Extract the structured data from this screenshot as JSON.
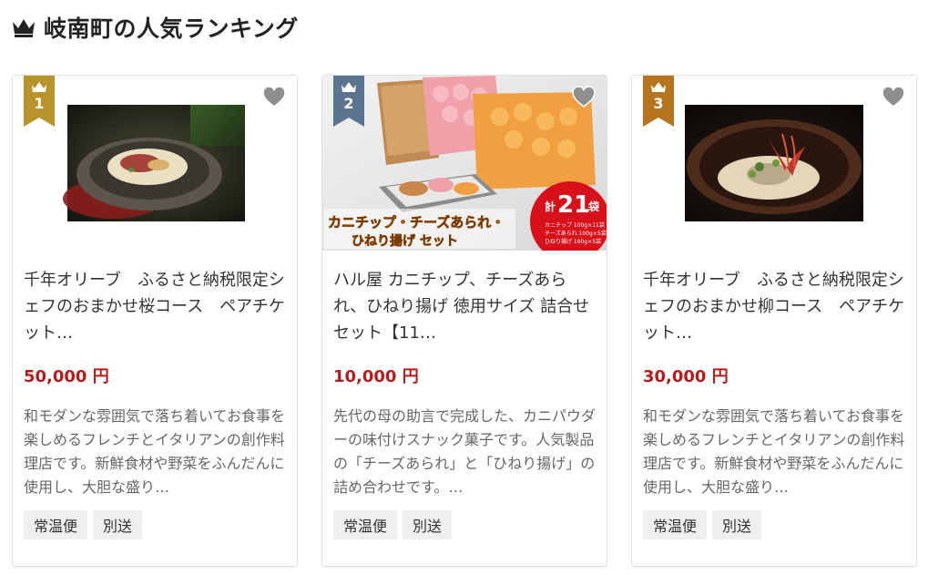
{
  "page": {
    "title": "岐南町の人気ランキング"
  },
  "colors": {
    "rank1": "#b8922a",
    "rank2": "#5b7590",
    "rank3": "#b5741d",
    "price": "#b71c1c"
  },
  "cards": [
    {
      "rank": "1",
      "name": "千年オリーブ　ふるさと納税限定シェフのおまかせ桜コース　ペアチケット…",
      "price": "50,000 円",
      "description": "和モダンな雰囲気で落ち着いてお食事を楽しめるフレンチとイタリアンの創作料理店です。新鮮食材や野菜をふんだんに使用し、大胆な盛り…",
      "tags": [
        "常温便",
        "別送"
      ]
    },
    {
      "rank": "2",
      "name": "ハル屋 カニチップ、チーズあられ、ひねり揚げ 徳用サイズ 詰合せセット【11…",
      "price": "10,000 円",
      "description": "先代の母の助言で完成した、カニパウダーの味付けスナック菓子です。人気製品の「チーズあられ」と「ひねり揚げ」の詰め合わせです。…",
      "tags": [
        "常温便",
        "別送"
      ],
      "image_text": {
        "banner_line1": "カニチップ・チーズあられ・",
        "banner_line2": "ひねり揚げ セット",
        "count_prefix": "計",
        "count_number": "21",
        "count_suffix": "袋",
        "detail1": "カニチップ 100g×11袋",
        "detail2": "チーズあられ 100g×5袋",
        "detail3": "ひねり揚げ 160g×5袋"
      }
    },
    {
      "rank": "3",
      "name": "千年オリーブ　ふるさと納税限定シェフのおまかせ柳コース　ペアチケット…",
      "price": "30,000 円",
      "description": "和モダンな雰囲気で落ち着いてお食事を楽しめるフレンチとイタリアンの創作料理店です。新鮮食材や野菜をふんだんに使用し、大胆な盛り…",
      "tags": [
        "常温便",
        "別送"
      ]
    }
  ]
}
